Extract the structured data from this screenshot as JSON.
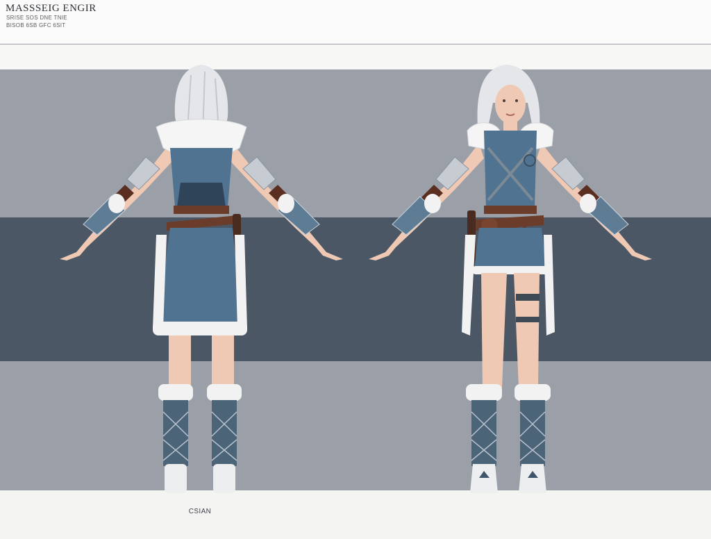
{
  "sheet": {
    "title": "MASSSEIG ENGIR",
    "subtitle_line1": "SRISE SOS DNE TNIE",
    "subtitle_line2": "BISOB 6SB GFC 6SIT",
    "caption": "CSIAN"
  },
  "views": [
    {
      "id": "back",
      "label": ""
    },
    {
      "id": "front",
      "label": ""
    }
  ],
  "colors": {
    "background_light": "#9ba0a8",
    "background_band": "#4b5764",
    "dress_blue": "#4f7390",
    "fur_white": "#f2f2f2",
    "leather_brown": "#6b3c2a",
    "skin": "#efc9b4",
    "hair_silver": "#e4e6ea"
  }
}
